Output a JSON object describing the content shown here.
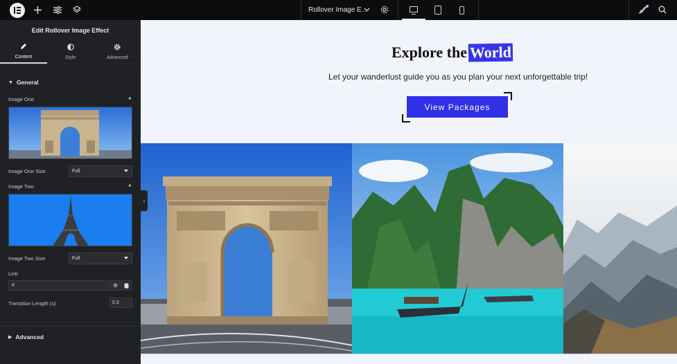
{
  "topbar": {
    "document_title": "Rollover Image E...",
    "icons": [
      "elementor-logo-icon",
      "plus-icon",
      "sliders-icon",
      "layers-icon",
      "chevron-down-icon",
      "gear-icon",
      "desktop-icon",
      "tablet-icon",
      "mobile-icon",
      "rocket-icon",
      "search-icon"
    ],
    "active_device": "desktop"
  },
  "panel": {
    "title": "Edit Rollover Image Effect",
    "tabs": [
      {
        "label": "Content",
        "icon": "pencil-icon",
        "active": true
      },
      {
        "label": "Style",
        "icon": "contrast-icon",
        "active": false
      },
      {
        "label": "Advanced",
        "icon": "gear-icon",
        "active": false
      }
    ],
    "general": {
      "title": "General",
      "image_one_label": "Image One",
      "image_one_size_label": "Image One Size",
      "image_one_size_value": "Full",
      "image_two_label": "Image Two",
      "image_two_size_label": "Image Two Size",
      "image_two_size_value": "Full",
      "link_label": "Link",
      "link_value": "#",
      "transition_label": "Transition Length (s)",
      "transition_value": "0.3"
    },
    "advanced_section": {
      "title": "Advanced"
    }
  },
  "canvas": {
    "heading_prefix": "Explore the",
    "heading_highlight": "World",
    "subtitle": "Let your wanderlust guide you as you plan your next unforgettable trip!",
    "cta_label": "View Packages",
    "colors": {
      "accent": "#3030e6",
      "canvas_bg": "#f2f4fb",
      "panel_bg": "#1f2124",
      "topbar_bg": "#0c0d0e"
    }
  }
}
